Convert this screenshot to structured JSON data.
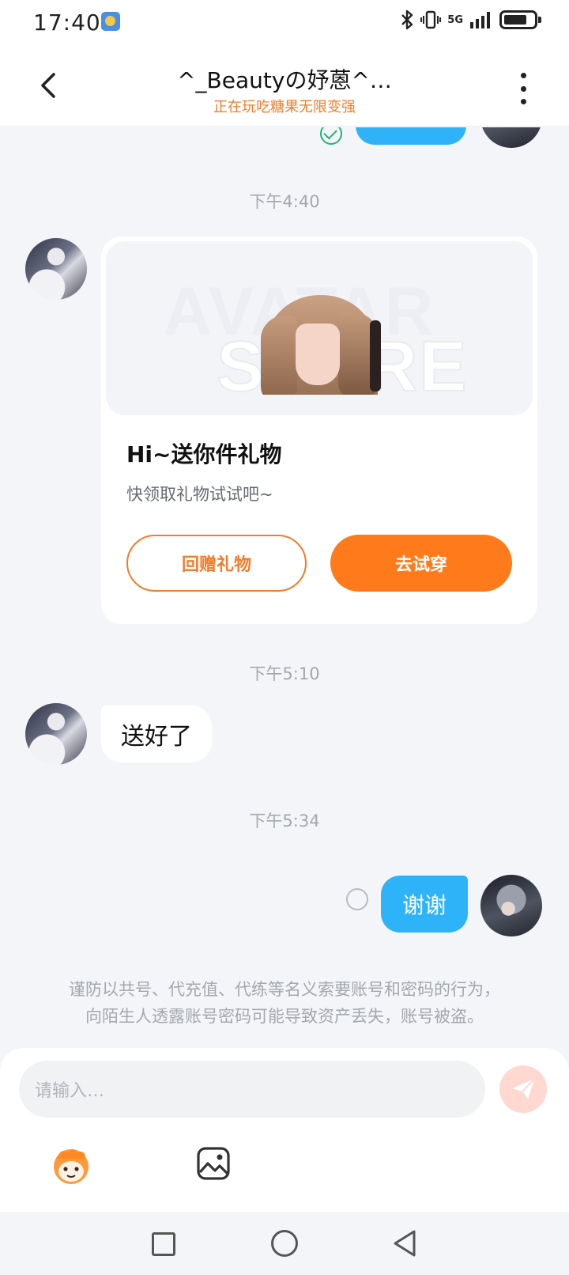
{
  "status_bar": {
    "time": "17:40",
    "network": "5G",
    "weather_icon": "weather-sun-icon",
    "icons": [
      "bluetooth-icon",
      "vibrate-icon",
      "signal-icon",
      "battery-icon"
    ]
  },
  "header": {
    "title": "^_Beautyの妤蒽^…",
    "subtitle": "正在玩吃糖果无限变强",
    "back_icon": "chevron-left-icon",
    "more_icon": "more-vertical-icon"
  },
  "messages": {
    "timestamp_1": "下午4:40",
    "gift_card": {
      "banner_line1": "AVATAR",
      "banner_line2": "STORE",
      "title": "Hi~送你件礼物",
      "description": "快领取礼物试试吧~",
      "return_gift_button": "回赠礼物",
      "try_on_button": "去试穿"
    },
    "timestamp_2": "下午5:10",
    "received_message": "送好了",
    "timestamp_3": "下午5:34",
    "sent_message": "谢谢"
  },
  "warning": {
    "line1": "谨防以共号、代充值、代练等名义索要账号和密码的行为，",
    "line2": "向陌生人透露账号密码可能导致资产丢失，账号被盗。"
  },
  "input": {
    "placeholder": "请输入…",
    "send_icon": "send-icon",
    "emoji_icon": "emoji-mascot-icon",
    "image_icon": "image-icon"
  },
  "colors": {
    "accent_orange": "#ff7a1a",
    "bubble_blue": "#2fb3f8",
    "read_green": "#22b573"
  }
}
